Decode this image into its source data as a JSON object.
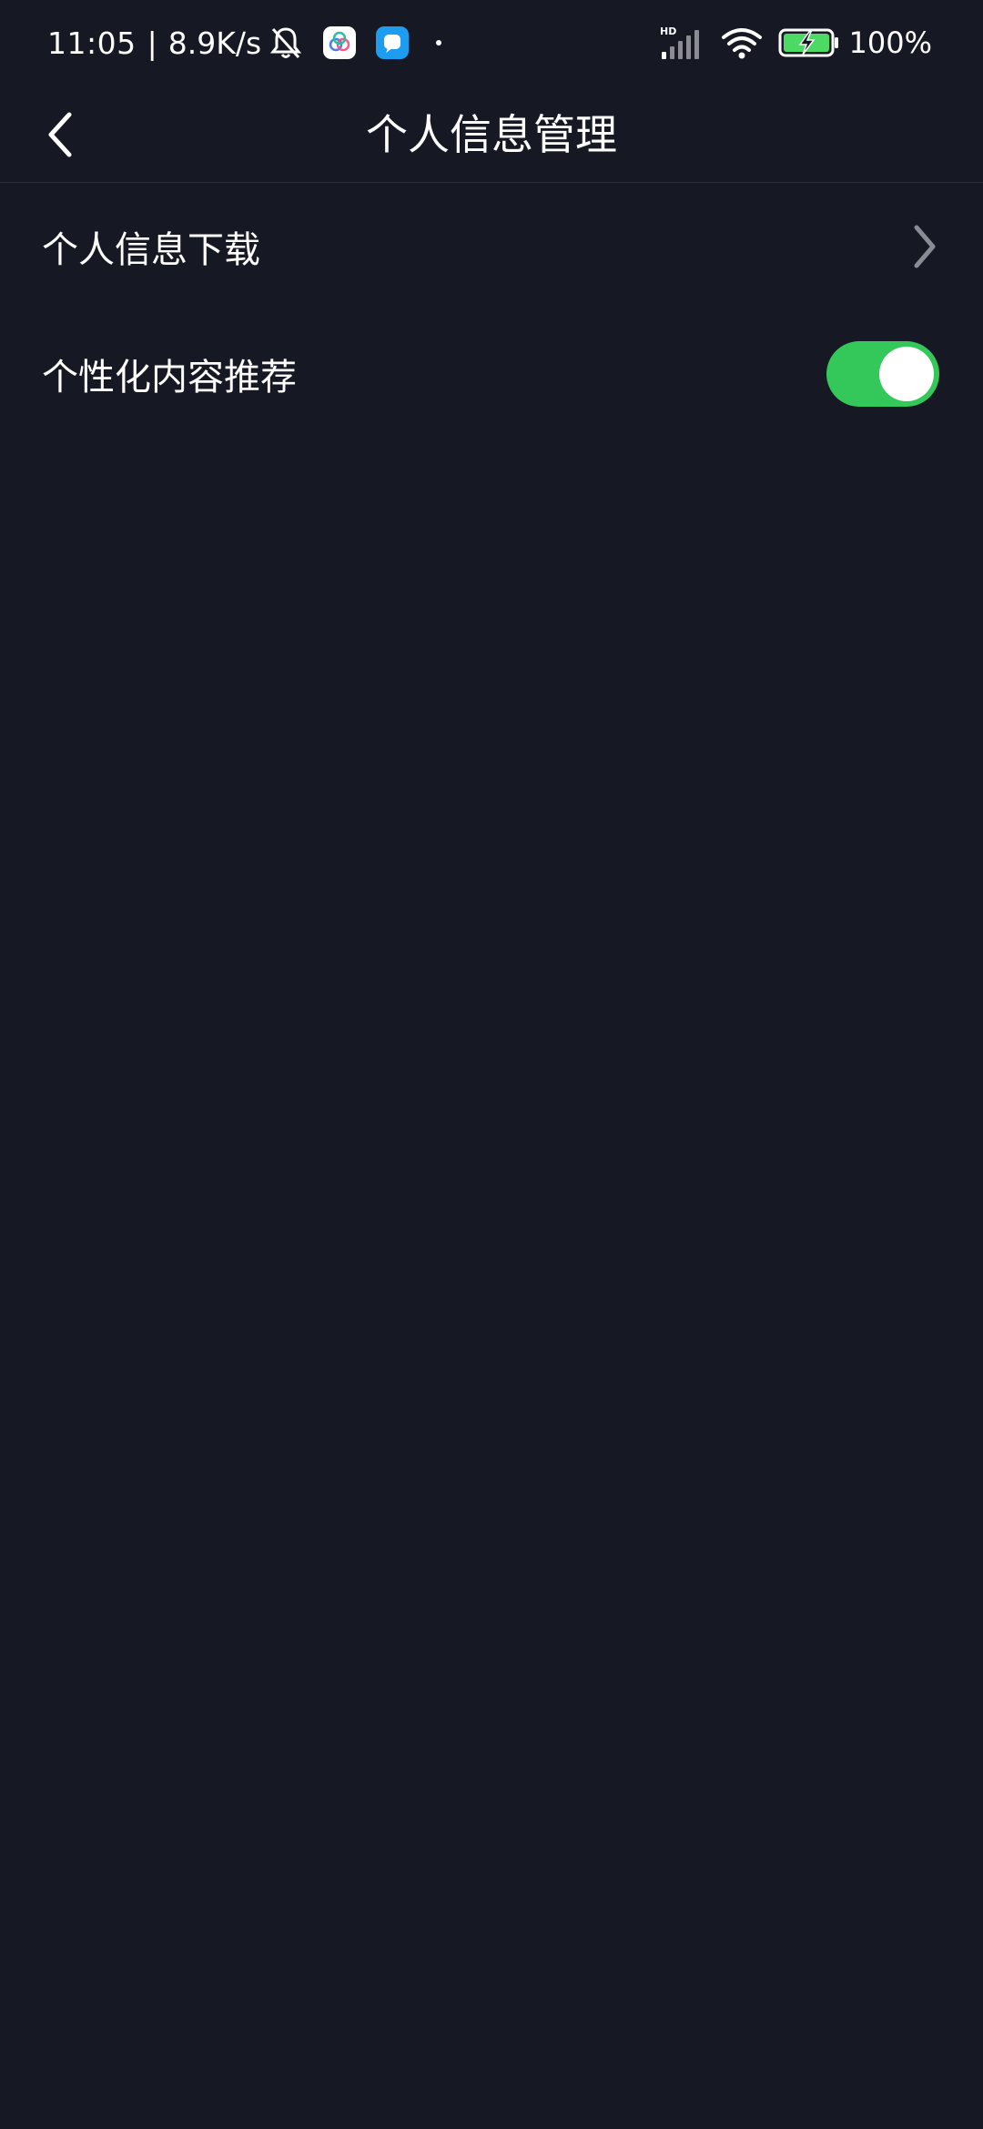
{
  "status_bar": {
    "time": "11:05",
    "separator": "|",
    "network_speed": "8.9K/s",
    "battery_percent": "100%",
    "signal_label": "HD",
    "icons": [
      "bell-muted-icon",
      "app-icon-white",
      "app-icon-blue",
      "dot-icon",
      "signal-icon",
      "wifi-icon",
      "battery-charging-icon"
    ]
  },
  "header": {
    "title": "个人信息管理",
    "back_icon": "chevron-left-icon"
  },
  "settings": {
    "items": [
      {
        "label": "个人信息下载",
        "control": "chevron-right-icon"
      },
      {
        "label": "个性化内容推荐",
        "control": "toggle",
        "enabled": true
      }
    ]
  },
  "colors": {
    "background": "#161823",
    "toggle_on": "#34c759",
    "chevron": "#8a8b93",
    "battery_fill": "#4cd964"
  }
}
